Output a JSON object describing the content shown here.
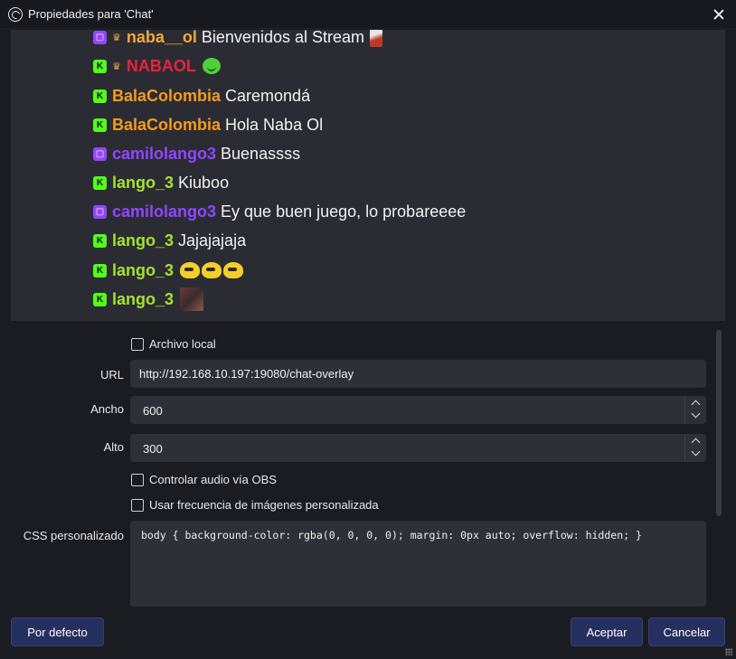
{
  "window": {
    "title": "Propiedades para 'Chat'",
    "icons": {
      "app": "obs-logo-icon",
      "close": "close-icon"
    }
  },
  "preview": {
    "background": "#2b2c33",
    "messages": [
      {
        "platform": "twitch",
        "crown": true,
        "user": "naba__ol",
        "user_color": "#f2a93b",
        "text": "Bienvenidos al Stream",
        "emote": "knife"
      },
      {
        "platform": "kick",
        "crown": true,
        "user": "NABAOL",
        "user_color": "#e8223f",
        "text": "",
        "emote": "frog"
      },
      {
        "platform": "kick",
        "crown": false,
        "user": "BalaColombia",
        "user_color": "#f59b1d",
        "text": "Caremondá",
        "emote": ""
      },
      {
        "platform": "kick",
        "crown": false,
        "user": "BalaColombia",
        "user_color": "#f59b1d",
        "text": "Hola Naba Ol",
        "emote": ""
      },
      {
        "platform": "twitch",
        "crown": false,
        "user": "camilolango3",
        "user_color": "#9146ff",
        "text": "Buenassss",
        "emote": ""
      },
      {
        "platform": "kick",
        "crown": false,
        "user": "lango_3",
        "user_color": "#a6e22e",
        "text": "Kiuboo",
        "emote": ""
      },
      {
        "platform": "twitch",
        "crown": false,
        "user": "camilolango3",
        "user_color": "#9146ff",
        "text": "Ey que buen juego, lo probareeee",
        "emote": ""
      },
      {
        "platform": "kick",
        "crown": false,
        "user": "lango_3",
        "user_color": "#a6e22e",
        "text": "Jajajajaja",
        "emote": ""
      },
      {
        "platform": "kick",
        "crown": false,
        "user": "lango_3",
        "user_color": "#a6e22e",
        "text": "",
        "emote": "duck-x3"
      },
      {
        "platform": "kick",
        "crown": false,
        "user": "lango_3",
        "user_color": "#a6e22e",
        "text": "",
        "emote": "photo"
      }
    ]
  },
  "form": {
    "local_file": {
      "label": "Archivo local",
      "checked": false
    },
    "url": {
      "label": "URL",
      "value": "http://192.168.10.197:19080/chat-overlay"
    },
    "width": {
      "label": "Ancho",
      "value": "600"
    },
    "height": {
      "label": "Alto",
      "value": "300"
    },
    "control_audio": {
      "label": "Controlar audio vía OBS",
      "checked": false
    },
    "custom_fps": {
      "label": "Usar frecuencia de imágenes personalizada",
      "checked": false
    },
    "custom_css": {
      "label": "CSS personalizado",
      "value": "body { background-color: rgba(0, 0, 0, 0); margin: 0px auto; overflow: hidden; }"
    }
  },
  "buttons": {
    "defaults": "Por defecto",
    "accept": "Aceptar",
    "cancel": "Cancelar"
  },
  "colors": {
    "dialog_bg": "#1b1c22",
    "field_bg": "#2f3037",
    "button_bg": "#26305e",
    "kick_green": "#53fc18",
    "twitch_purple": "#9146ff"
  }
}
